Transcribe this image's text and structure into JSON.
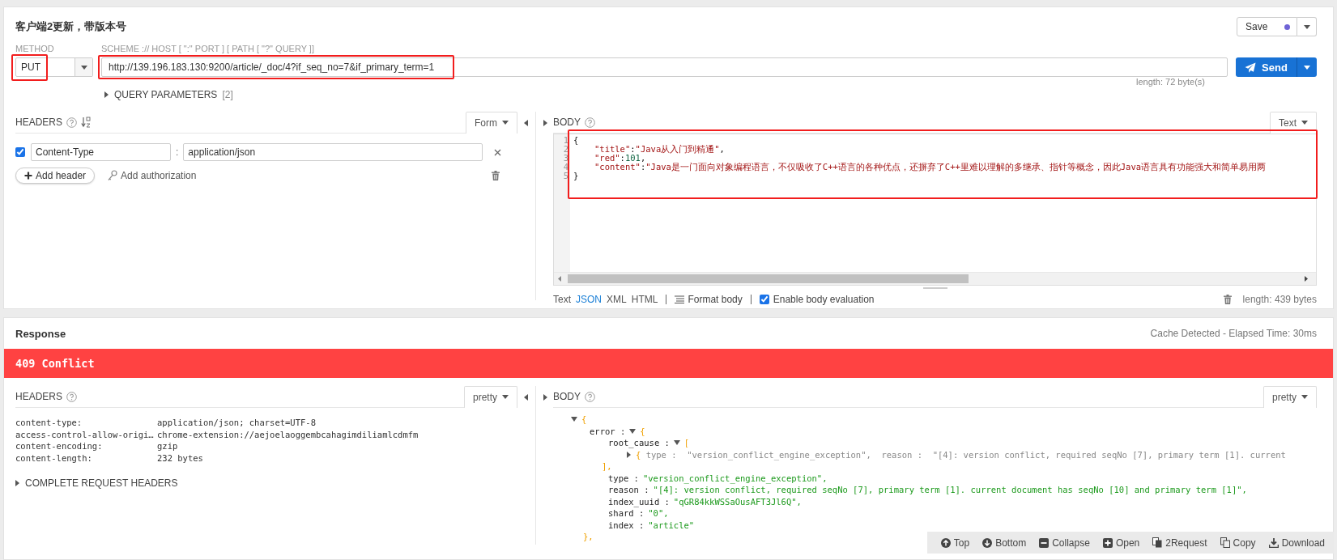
{
  "request": {
    "title": "客户端2更新，带版本号",
    "save_button": "Save",
    "method_label": "METHOD",
    "method": "PUT",
    "url_label": "SCHEME :// HOST [ \":\" PORT ] [ PATH [ \"?\" QUERY ]]",
    "url": "http://139.196.183.130:9200/article/_doc/4?if_seq_no=7&if_primary_term=1",
    "url_length": "length: 72 byte(s)",
    "send_button": "Send",
    "query_parameters": {
      "label": "QUERY PARAMETERS",
      "count": "[2]",
      "expanded": false
    }
  },
  "request_headers": {
    "title": "HEADERS",
    "mode": "Form",
    "rows": [
      {
        "checked": true,
        "name": "Content-Type",
        "separator": ":",
        "value": "application/json"
      }
    ],
    "add_header": "Add header",
    "add_authorization": "Add authorization"
  },
  "request_body": {
    "title": "BODY",
    "mode": "Text",
    "line_numbers": [
      "1",
      "2",
      "3",
      "4",
      "5"
    ],
    "lines": [
      {
        "indent": false,
        "tokens": [
          {
            "kind": "punct",
            "text": "{"
          }
        ]
      },
      {
        "indent": true,
        "tokens": [
          {
            "kind": "key",
            "text": "\"title\""
          },
          {
            "kind": "punct",
            "text": ":"
          },
          {
            "kind": "string",
            "text": "\"Java从入门到精通\""
          },
          {
            "kind": "punct",
            "text": ","
          }
        ]
      },
      {
        "indent": true,
        "tokens": [
          {
            "kind": "key",
            "text": "\"red\""
          },
          {
            "kind": "punct",
            "text": ":"
          },
          {
            "kind": "number",
            "text": "101"
          },
          {
            "kind": "punct",
            "text": ","
          }
        ]
      },
      {
        "indent": true,
        "tokens": [
          {
            "kind": "key",
            "text": "\"content\""
          },
          {
            "kind": "punct",
            "text": ":"
          },
          {
            "kind": "string",
            "text": "\"Java是一门面向对象编程语言，不仅吸收了C++语言的各种优点，还摒弃了C++里难以理解的多继承、指针等概念，因此Java语言具有功能强大和简单易用两"
          }
        ]
      },
      {
        "indent": false,
        "tokens": [
          {
            "kind": "punct",
            "text": "}"
          }
        ]
      }
    ],
    "formats": [
      {
        "label": "Text",
        "selected": false
      },
      {
        "label": "JSON",
        "selected": true
      },
      {
        "label": "XML",
        "selected": false
      },
      {
        "label": "HTML",
        "selected": false
      }
    ],
    "format_body": "Format body",
    "evaluation": {
      "label": "Enable body evaluation",
      "checked": true
    },
    "length": "length: 439 bytes"
  },
  "response": {
    "title": "Response",
    "timing": "Cache Detected - Elapsed Time: 30ms",
    "status": "409 Conflict",
    "headers": {
      "title": "HEADERS",
      "mode": "pretty",
      "rows": [
        {
          "name": "content-type:",
          "value": "application/json; charset=UTF-8"
        },
        {
          "name": "access-control-allow-origi…",
          "value": "chrome-extension://aejoelaoggembcahagimdiliamlcdmfm"
        },
        {
          "name": "content-encoding:",
          "value": "gzip"
        },
        {
          "name": "content-length:",
          "value": "232 bytes"
        }
      ],
      "complete_headers": {
        "label": "COMPLETE REQUEST HEADERS",
        "expanded": false
      }
    },
    "body": {
      "title": "BODY",
      "mode": "pretty",
      "tree": {
        "expanded": true,
        "open": "{",
        "children": [
          {
            "key": "error :",
            "expanded": true,
            "open": "{",
            "close": "},",
            "children": [
              {
                "key": "root_cause :",
                "expanded": true,
                "open": "[",
                "close": "],",
                "children": [
                  {
                    "expanded": false,
                    "open": "{",
                    "summary": "type :  \"version_conflict_engine_exception\",  reason :  \"[4]: version conflict, required seqNo [7], primary term [1]. current"
                  }
                ]
              },
              {
                "key": "type :",
                "value": "\"version_conflict_engine_exception\","
              },
              {
                "key": "reason :",
                "value": "\"[4]: version conflict, required seqNo [7], primary term [1]. current document has seqNo [10] and primary term [1]\","
              },
              {
                "key": "index_uuid :",
                "value": "\"qGR84kkWSSaOusAFT3Jl6Q\","
              },
              {
                "key": "shard :",
                "value": "\"0\","
              },
              {
                "key": "index :",
                "value": "\"article\""
              }
            ]
          }
        ]
      }
    },
    "toolbar": [
      {
        "kind": "top",
        "label": "Top"
      },
      {
        "kind": "bottom",
        "label": "Bottom"
      },
      {
        "kind": "collapse",
        "label": "Collapse"
      },
      {
        "kind": "open",
        "label": "Open"
      },
      {
        "kind": "request",
        "label": "2Request"
      },
      {
        "kind": "copy",
        "label": "Copy"
      },
      {
        "kind": "download",
        "label": "Download"
      }
    ]
  }
}
